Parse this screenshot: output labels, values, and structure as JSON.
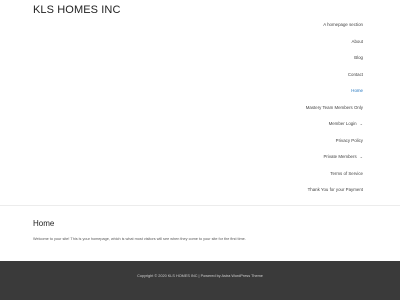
{
  "site": {
    "title": "KLS HOMES INC"
  },
  "nav": {
    "items": [
      {
        "label": "A homepage section"
      },
      {
        "label": "About"
      },
      {
        "label": "Blog"
      },
      {
        "label": "Contact"
      },
      {
        "label": "Home",
        "active": true
      },
      {
        "label": "Mastery Team Members Only"
      },
      {
        "label": "Member Login",
        "has_submenu": true
      },
      {
        "label": "Privacy Policy"
      },
      {
        "label": "Private Members",
        "has_submenu": true
      },
      {
        "label": "Terms of Service"
      },
      {
        "label": "Thank You for your Payment"
      }
    ],
    "chevron": "⌄"
  },
  "main": {
    "page_title": "Home",
    "intro": "Welcome to your site! This is your homepage, which is what most visitors will see when they come to your site for the first time."
  },
  "footer": {
    "copyright": "Copyright © 2020 KLS HOMES INC | Powered by Astra WordPress Theme"
  },
  "colors": {
    "accent": "#1e73be",
    "footer_bg": "#3a3a3a"
  }
}
